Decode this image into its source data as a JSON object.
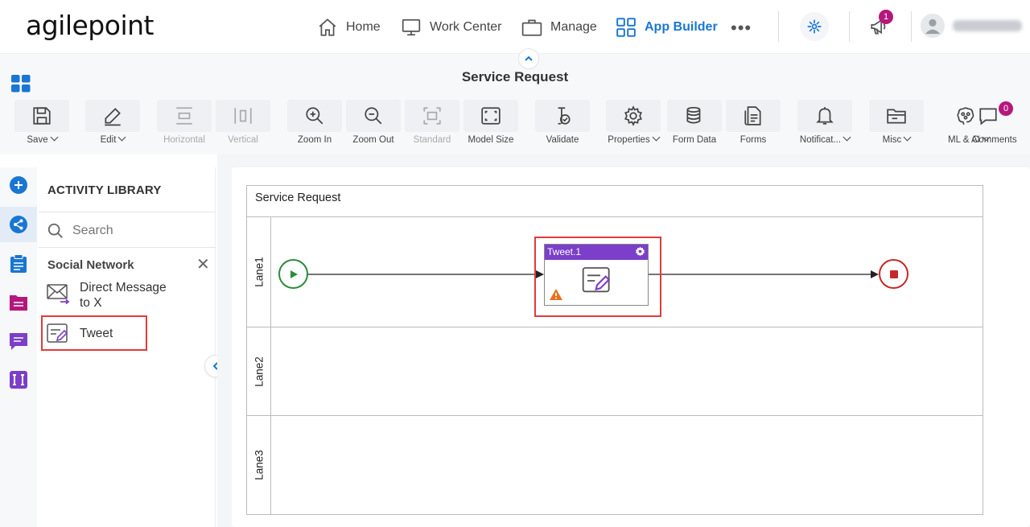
{
  "nav": {
    "logo": "agilepoint",
    "items": [
      {
        "label": "Home",
        "icon": "home-icon"
      },
      {
        "label": "Work Center",
        "icon": "monitor-icon"
      },
      {
        "label": "Manage",
        "icon": "briefcase-icon"
      },
      {
        "label": "App Builder",
        "icon": "grid-icon",
        "active": true
      }
    ],
    "more": "•••",
    "notification_count": "1"
  },
  "header": {
    "title": "Service Request"
  },
  "toolbar": {
    "save": "Save",
    "edit": "Edit",
    "horizontal": "Horizontal",
    "vertical": "Vertical",
    "zoom_in": "Zoom In",
    "zoom_out": "Zoom Out",
    "standard": "Standard",
    "model_size": "Model Size",
    "validate": "Validate",
    "properties": "Properties",
    "form_data": "Form Data",
    "forms": "Forms",
    "notifications": "Notificat...",
    "misc": "Misc",
    "ml_ai": "ML & AI",
    "comments": "Comments",
    "comments_count": "0"
  },
  "library": {
    "title": "ACTIVITY LIBRARY",
    "search_placeholder": "Search",
    "category": "Social Network",
    "items": [
      {
        "label_line1": "Direct Message",
        "label_line2": "to X",
        "icon": "direct-message-icon"
      },
      {
        "label_line1": "Tweet",
        "label_line2": "",
        "icon": "tweet-icon"
      }
    ]
  },
  "canvas": {
    "pool_title": "Service Request",
    "lanes": [
      "Lane1",
      "Lane2",
      "Lane3"
    ],
    "task_title": "Tweet.1"
  },
  "colors": {
    "accent": "#1976d2",
    "task_header": "#7b3fc9",
    "start": "#2e8b3a",
    "end": "#c62828",
    "highlight": "#e03b3b",
    "badge": "#b5177d"
  }
}
